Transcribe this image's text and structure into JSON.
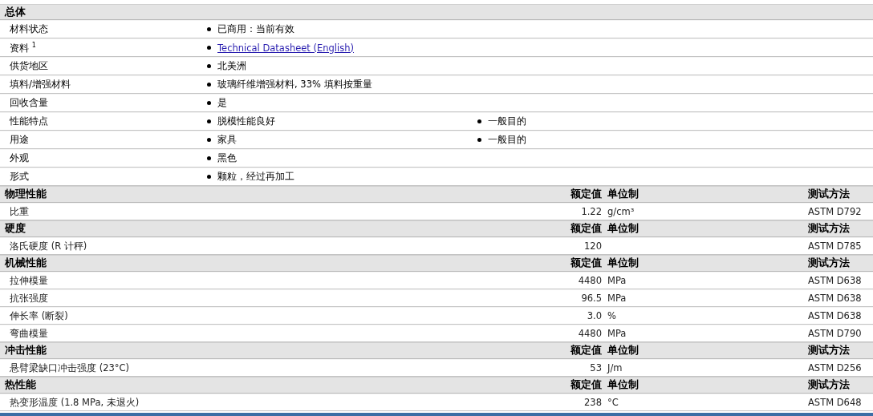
{
  "general": {
    "title": "总体",
    "rows": [
      {
        "label": "材料状态",
        "values": [
          {
            "kind": "text",
            "text": "已商用：当前有效"
          }
        ]
      },
      {
        "label": "资料 $^{1}$",
        "values": [
          {
            "kind": "link",
            "text": "Technical Datasheet (English)"
          }
        ]
      },
      {
        "label": "供货地区",
        "values": [
          {
            "kind": "text",
            "text": "北美洲"
          }
        ]
      },
      {
        "label": "填料/增强材料",
        "values": [
          {
            "kind": "text",
            "text": "玻璃纤维增强材料, 33% 填料按重量"
          }
        ]
      },
      {
        "label": "回收含量",
        "values": [
          {
            "kind": "text",
            "text": "是"
          }
        ]
      },
      {
        "label": "性能特点",
        "values": [
          {
            "kind": "text",
            "text": "脱模性能良好"
          },
          {
            "kind": "text",
            "text": "一般目的"
          }
        ]
      },
      {
        "label": "用途",
        "values": [
          {
            "kind": "text",
            "text": "家具"
          },
          {
            "kind": "text",
            "text": "一般目的"
          }
        ]
      },
      {
        "label": "外观",
        "values": [
          {
            "kind": "text",
            "text": "黑色"
          }
        ]
      },
      {
        "label": "形式",
        "values": [
          {
            "kind": "text",
            "text": "颗粒，经过再加工"
          }
        ]
      }
    ]
  },
  "sections": [
    {
      "title": "物理性能",
      "value_heading": "额定值",
      "unit_heading": "单位制",
      "method_heading": "测试方法",
      "rows": [
        {
          "name": "比重",
          "value": "1.22",
          "unit": "g/cm³",
          "method": "ASTM D792"
        }
      ]
    },
    {
      "title": "硬度",
      "value_heading": "额定值",
      "unit_heading": "单位制",
      "method_heading": "测试方法",
      "rows": [
        {
          "name": "洛氏硬度 (R 计秤)",
          "value": "120",
          "method": "ASTM D785"
        }
      ]
    },
    {
      "title": "机械性能",
      "value_heading": "额定值",
      "unit_heading": "单位制",
      "method_heading": "测试方法",
      "rows": [
        {
          "name": "拉伸模量",
          "value": "4480",
          "unit": "MPa",
          "method": "ASTM D638"
        },
        {
          "name": "抗张强度",
          "value": "96.5",
          "unit": "MPa",
          "method": "ASTM D638"
        },
        {
          "name": "伸长率 (断裂)",
          "value": "3.0",
          "unit": "%",
          "method": "ASTM D638"
        },
        {
          "name": "弯曲模量",
          "value": "4480",
          "unit": "MPa",
          "method": "ASTM D790"
        }
      ]
    },
    {
      "title": "冲击性能",
      "value_heading": "额定值",
      "unit_heading": "单位制",
      "method_heading": "测试方法",
      "rows": [
        {
          "name": "悬臂梁缺口冲击强度 (23°C)",
          "value": "53",
          "unit": "J/m",
          "method": "ASTM D256"
        }
      ]
    },
    {
      "title": "热性能",
      "value_heading": "额定值",
      "unit_heading": "单位制",
      "method_heading": "测试方法",
      "rows": [
        {
          "name": "热变形温度 (1.8 MPa, 未退火)",
          "value": "238",
          "unit": "°C",
          "method": "ASTM D648"
        }
      ]
    }
  ]
}
